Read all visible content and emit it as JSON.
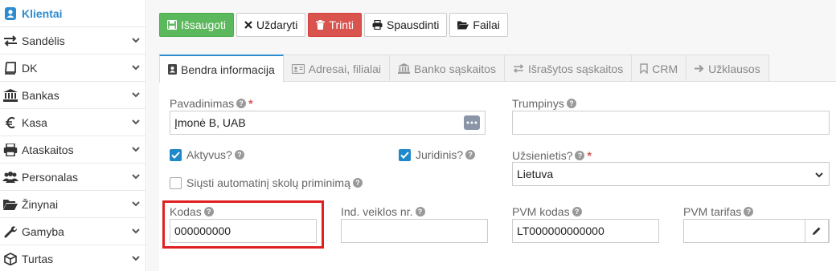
{
  "sidebar": {
    "items": [
      {
        "label": "Klientai",
        "icon": "person-card-icon",
        "active": true
      },
      {
        "label": "Sandėlis",
        "icon": "arrows-exchange-icon"
      },
      {
        "label": "DK",
        "icon": "book-icon"
      },
      {
        "label": "Bankas",
        "icon": "bank-icon"
      },
      {
        "label": "Kasa",
        "icon": "euro-icon"
      },
      {
        "label": "Ataskaitos",
        "icon": "printer-icon"
      },
      {
        "label": "Personalas",
        "icon": "users-icon"
      },
      {
        "label": "Žinynai",
        "icon": "folder-open-icon"
      },
      {
        "label": "Gamyba",
        "icon": "wrench-icon"
      },
      {
        "label": "Turtas",
        "icon": "cube-icon"
      }
    ]
  },
  "toolbar": {
    "save": "Išsaugoti",
    "close": "Uždaryti",
    "delete": "Trinti",
    "print": "Spausdinti",
    "files": "Failai"
  },
  "tabs": [
    {
      "label": "Bendra informacija",
      "icon": "id-card-icon",
      "active": true
    },
    {
      "label": "Adresai, filialai",
      "icon": "address-card-icon"
    },
    {
      "label": "Banko sąskaitos",
      "icon": "bank-icon"
    },
    {
      "label": "Išrašytos sąskaitos",
      "icon": "arrows-exchange-icon"
    },
    {
      "label": "CRM",
      "icon": "bookmark-icon"
    },
    {
      "label": "Užklausos",
      "icon": "arrow-right-icon"
    }
  ],
  "form": {
    "pavadinimas_label": "Pavadinimas",
    "pavadinimas_value": "Įmonė B, UAB",
    "trumpinys_label": "Trumpinys",
    "trumpinys_value": "",
    "aktyvus_label": "Aktyvus?",
    "aktyvus_checked": true,
    "juridinis_label": "Juridinis?",
    "juridinis_checked": true,
    "uzsienietis_label": "Užsienietis?",
    "uzsienietis_value": "Lietuva",
    "siusti_label": "Siųsti automatinį skolų priminimą",
    "siusti_checked": false,
    "kodas_label": "Kodas",
    "kodas_value": "000000000",
    "ind_label": "Ind. veiklos nr.",
    "ind_value": "",
    "pvm_kodas_label": "PVM kodas",
    "pvm_kodas_value": "LT000000000000",
    "pvm_tarifas_label": "PVM tarifas",
    "pvm_tarifas_value": "",
    "help_glyph": "?",
    "required_mark": "*"
  },
  "colors": {
    "accent": "#2e8bd0",
    "save_bg": "#5cb85c",
    "delete_bg": "#d9534f",
    "highlight": "#e02020",
    "checkbox": "#1e88c8"
  }
}
